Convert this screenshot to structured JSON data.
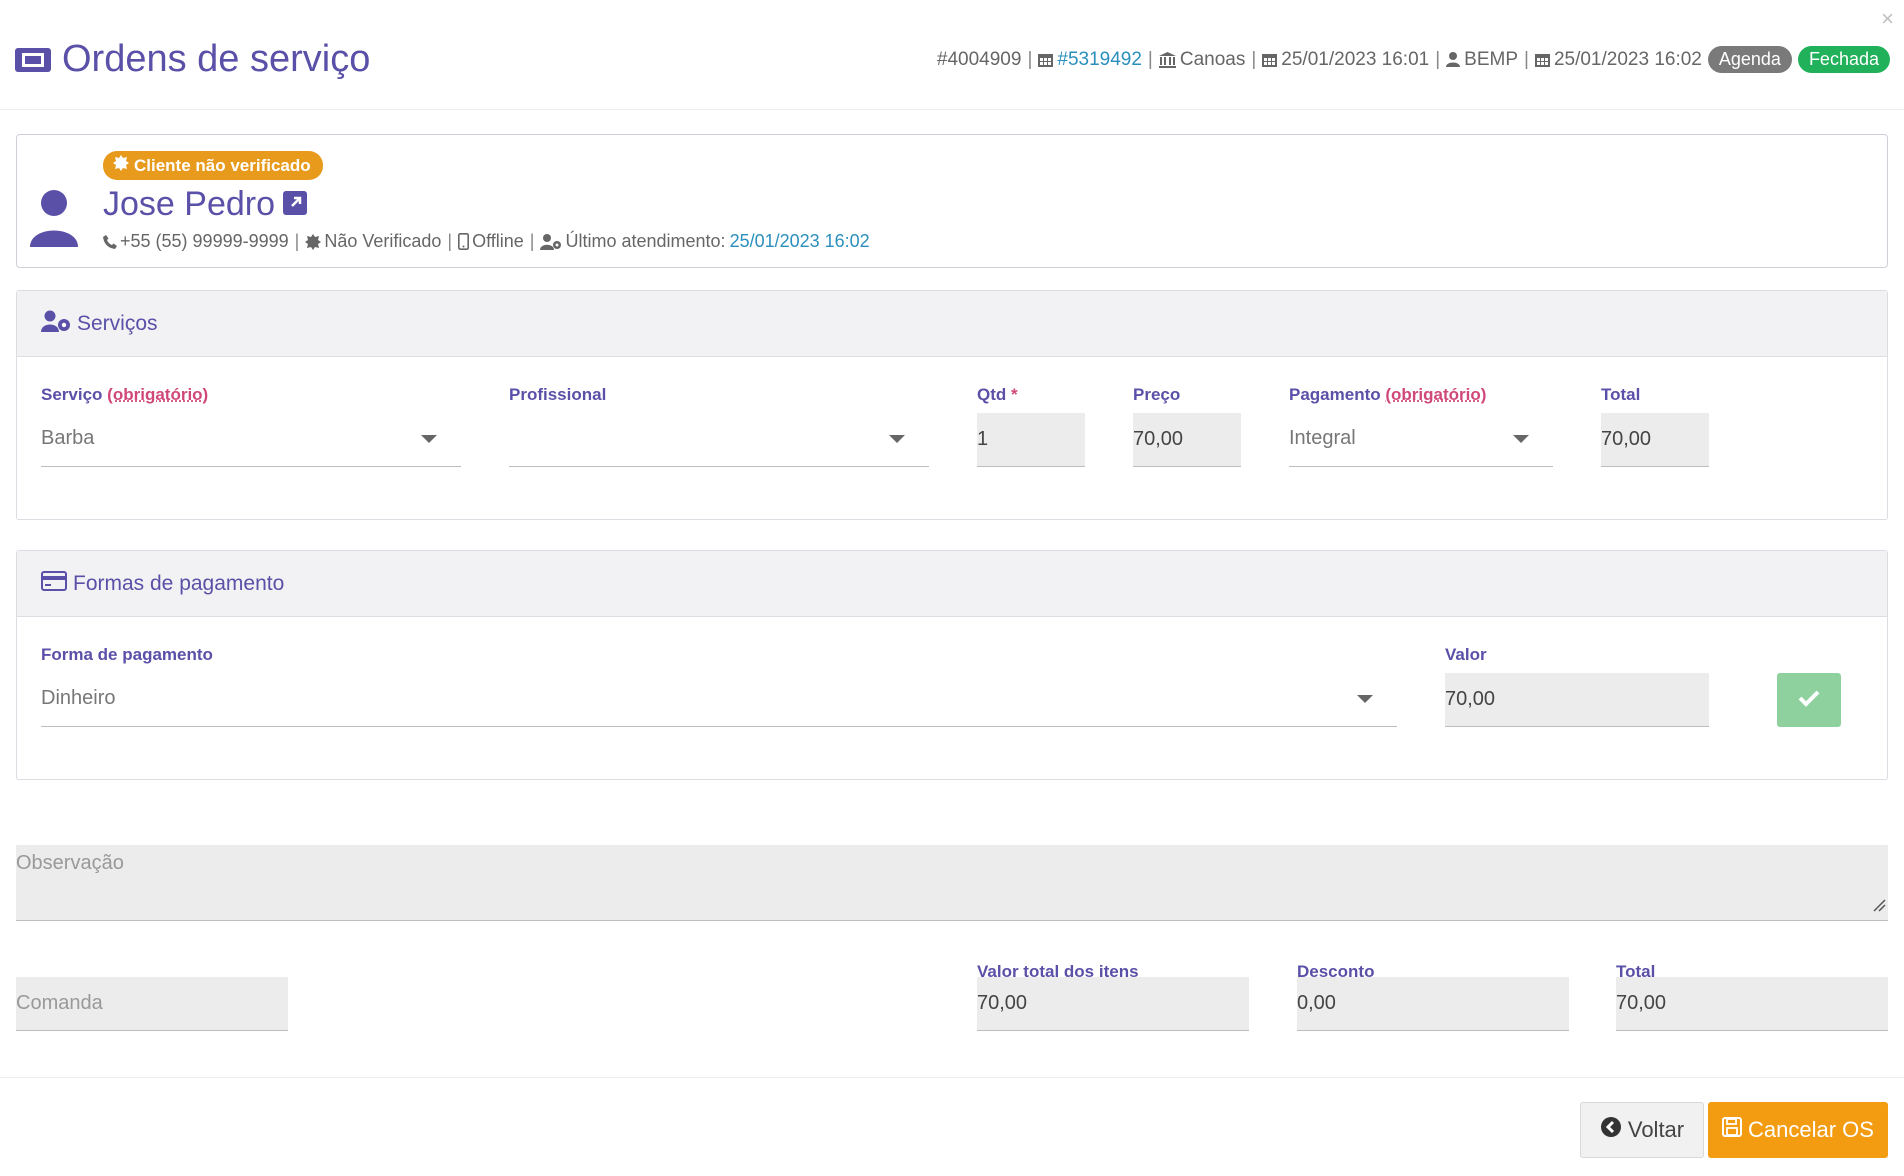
{
  "header": {
    "title": "Ordens de serviço",
    "meta": {
      "os_id": "#4004909",
      "appointment_link": "#5319492",
      "unit": "Canoas",
      "created_at": "25/01/2023 16:01",
      "user": "BEMP",
      "closed_at": "25/01/2023 16:02",
      "origin_badge": "Agenda",
      "status_badge": "Fechada"
    },
    "close_glyph": "×"
  },
  "client": {
    "badge": "Cliente não verificado",
    "name": "Jose Pedro",
    "phone": "+55 (55) 99999-9999",
    "verification": "Não Verificado",
    "online_status": "Offline",
    "last_service_label": "Último atendimento:",
    "last_service_date": "25/01/2023 16:02"
  },
  "services": {
    "title": "Serviços",
    "labels": {
      "service": "Serviço",
      "service_req": "(obrigatório)",
      "professional": "Profissional",
      "qty": "Qtd",
      "qty_star": "*",
      "price": "Preço",
      "payment": "Pagamento",
      "payment_req": "(obrigatório)",
      "total": "Total"
    },
    "values": {
      "service": "Barba",
      "professional": "",
      "qty": "1",
      "price": "70,00",
      "payment": "Integral",
      "total": "70,00"
    }
  },
  "payments": {
    "title": "Formas de pagamento",
    "labels": {
      "method": "Forma de pagamento",
      "value": "Valor"
    },
    "values": {
      "method": "Dinheiro",
      "value": "70,00"
    }
  },
  "observation": {
    "placeholder": "Observação"
  },
  "summary": {
    "comanda_placeholder": "Comanda",
    "items_total_label": "Valor total dos itens",
    "items_total": "70,00",
    "discount_label": "Desconto",
    "discount": "0,00",
    "total_label": "Total",
    "total": "70,00"
  },
  "actions": {
    "back": "Voltar",
    "cancel": "Cancelar OS"
  },
  "colors": {
    "primary": "#5a50a8",
    "link": "#2a8fbd",
    "warning": "#e89a1c",
    "success": "#21b15b",
    "confirm": "#8fd19e",
    "cancel": "#f39c12"
  },
  "icons": [
    "ticket-icon",
    "calendar-icon",
    "bank-icon",
    "user-icon",
    "certificate-icon",
    "external-link-icon",
    "phone-icon",
    "mobile-icon",
    "users-cog-icon",
    "credit-card-icon",
    "check-icon",
    "arrow-left-circle-icon",
    "save-icon",
    "resize-grip-icon"
  ]
}
